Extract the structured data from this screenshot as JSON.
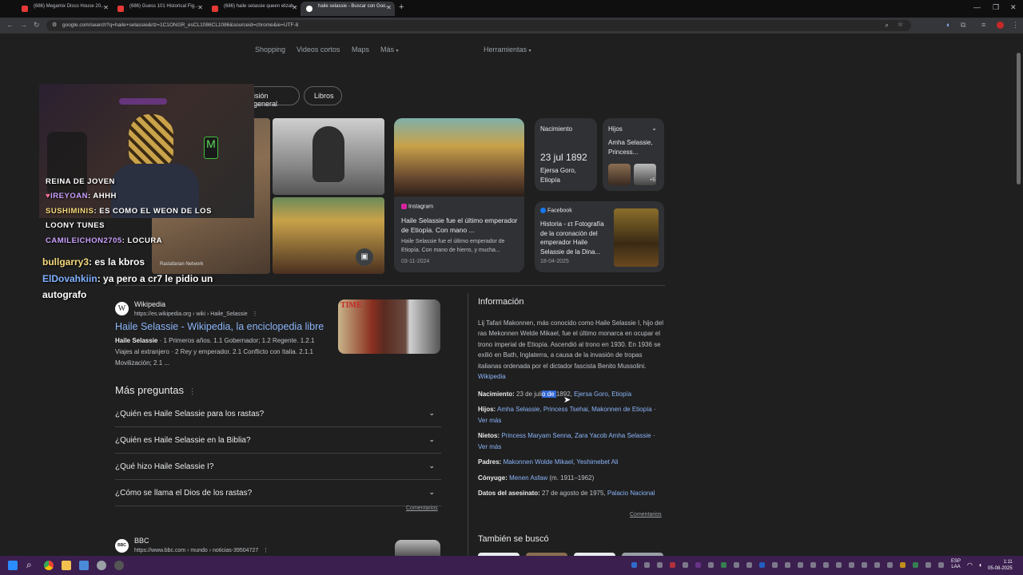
{
  "browser": {
    "tabs": [
      {
        "title": "(686) Megamix Disco House 20..."
      },
      {
        "title": "(686) Guess 101 Historical Fig..."
      },
      {
        "title": "(686) haile selassie queen elizab..."
      },
      {
        "title": "haile selassie - Buscar con Goo..."
      }
    ],
    "url": "google.com/search?q=haile+selassie&rlz=1C1ONGR_esCL1086CL1086&sourceid=chrome&ie=UTF-8"
  },
  "search_tabs": [
    "Shopping",
    "Videos cortos",
    "Maps",
    "Más",
    "Herramientas"
  ],
  "chips": [
    "isión general",
    "Libros"
  ],
  "stream": {
    "chat": [
      {
        "user": "REINA DE JOVEN",
        "msg": ""
      },
      {
        "user": "IREYOAN",
        "msg": ": AHHH"
      },
      {
        "user": "SUSHIMINIS",
        "msg": ": ES COMO EL WEON DE LOS"
      },
      {
        "user": "LOONY TUNES",
        "msg": ""
      },
      {
        "user": "CAMILEICHON2705",
        "msg": ": LOCURA"
      }
    ],
    "chat2": [
      {
        "user": "bullgarry3",
        "msg": ": es la kbros"
      },
      {
        "user": "ElDovahkiin",
        "msg": ": ya pero a cr7 le pidio un"
      },
      {
        "user": "",
        "msg": "autografo"
      }
    ],
    "overlay_source": "Rastafarian Network"
  },
  "cards": {
    "instagram": {
      "source": "Instagram",
      "title": "Haile Selassie fue el último emperador de Etiopía. Con mano ...",
      "snippet": "Haile Selassie fue el último emperador de Etiopía. Con mano de hierro, y mucha...",
      "date": "03-11-2024"
    },
    "facebook": {
      "source": "Facebook",
      "title": "Historia - ετ Fotografía de la coronación del emperador Haile Selassie de la Dina...",
      "date": "18-04-2025"
    },
    "nacimiento": {
      "label": "Nacimiento",
      "date": "23 jul 1892",
      "place": "Ejersa Goro, Etiopía"
    },
    "hijos": {
      "label": "Hijos",
      "names": "Amha Selassie, Princess...",
      "more": "+5"
    }
  },
  "wikipedia": {
    "site": "Wikipedia",
    "url": "https://es.wikipedia.org › wiki › Haile_Selassie",
    "title": "Haile Selassie - Wikipedia, la enciclopedia libre",
    "snippet_bold": "Haile Selassie",
    "snippet": " · 1 Primeros años. 1.1 Gobernador; 1.2 Regente. 1.2.1 Viajes al extranjero · 2 Rey y emperador. 2.1 Conflicto con Italia. 2.1.1 Movilización; 2.1 ..."
  },
  "more_questions": {
    "title": "Más preguntas",
    "items": [
      "¿Quién es Haile Selassie para los rastas?",
      "¿Quién es Haile Selassie en la Biblia?",
      "¿Qué hizo Haile Selassie I?",
      "¿Cómo se llama el Dios de los rastas?"
    ],
    "feedback": "Comentarios"
  },
  "bbc": {
    "site": "BBC",
    "url": "https://www.bbc.com › mundo › noticias-39504727"
  },
  "info": {
    "title": "Información",
    "description": "Lij Tafari Makonnen,  más conocido como Haile Selassie I, hijo del ras Mekonnen Welde Mikael, fue el último monarca en ocupar el trono imperial de Etiopía. Ascendió al trono en 1930. En 1936 se exilió en Bath, Inglaterra, a causa de la invasión de tropas italianas ordenada por el dictador fascista Benito Mussolini.",
    "desc_link": "Wikipedia",
    "nacimiento_label": "Nacimiento:",
    "nacimiento_pre": " 23 de juli",
    "nacimiento_sel": "o de ",
    "nacimiento_post": "1892, ",
    "nacimiento_link": "Ejersa Goro, Etiopía",
    "hijos_label": "Hijos:",
    "hijos_links": "Amha Selassie, Princess Tsehai, Makonnen de Etiopía",
    "ver_mas": "Ver más",
    "nietos_label": "Nietos:",
    "nietos_links": "Princess Maryam Senna, Zara Yacob Amha Selassie",
    "padres_label": "Padres:",
    "padres_links": "Makonnen Wolde Mikael, Yeshimebet Ali",
    "conyuge_label": "Cónyuge:",
    "conyuge_link": "Menen Asfaw",
    "conyuge_years": " (m. 1911–1962)",
    "asesinato_label": "Datos del asesinato:",
    "asesinato_date": " 27 de agosto de 1975, ",
    "asesinato_link": "Palacio Nacional",
    "feedback": "Comentarios",
    "tambien": "También se buscó"
  },
  "taskbar": {
    "lang": "ESP",
    "layout": "LAA",
    "time": "1:11",
    "date": "05-08-2025"
  },
  "colors": {
    "accent": "#8ab4f8",
    "bg": "#1f1f1f",
    "card": "#303134",
    "taskbar": "#3b1f4f",
    "chat_gold": "#f5d87a",
    "chat_blue": "#7fb0ff"
  }
}
